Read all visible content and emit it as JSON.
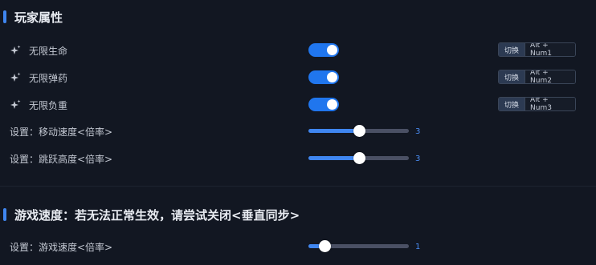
{
  "sections": [
    {
      "title": "玩家属性",
      "toggles": [
        {
          "label": "无限生命",
          "on": true,
          "hotkey_button": "切换",
          "hotkey": "Alt + Num1"
        },
        {
          "label": "无限弹药",
          "on": true,
          "hotkey_button": "切换",
          "hotkey": "Alt + Num2"
        },
        {
          "label": "无限负重",
          "on": true,
          "hotkey_button": "切换",
          "hotkey": "Alt + Num3"
        }
      ],
      "sliders": [
        {
          "label": "设置：移动速度<倍率>",
          "value": "3",
          "fraction": 0.5
        },
        {
          "label": "设置：跳跃高度<倍率>",
          "value": "3",
          "fraction": 0.5
        }
      ]
    },
    {
      "title": "游戏速度：若无法正常生效，请尝试关闭<垂直同步>",
      "sliders": [
        {
          "label": "设置：游戏速度<倍率>",
          "value": "1",
          "fraction": 0.16
        }
      ]
    }
  ],
  "colors": {
    "background": "#121722",
    "accent": "#3f86f0",
    "toggle_on": "#2076ee",
    "slider_value": "#4a8cf2"
  },
  "icons": {
    "toggle_row_icon": "sparkle-icon"
  }
}
